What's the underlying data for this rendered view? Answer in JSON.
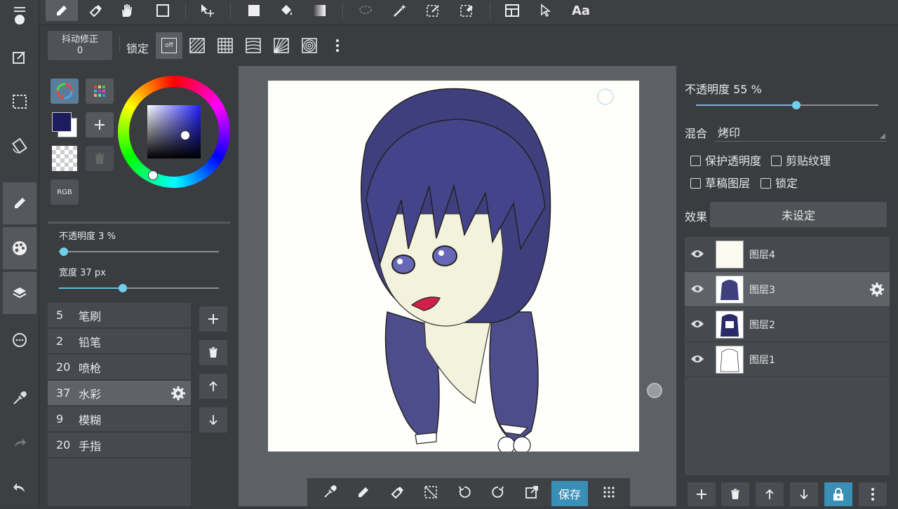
{
  "top_toolbar": {
    "text_tool_label": "Aa"
  },
  "sub_toolbar": {
    "stabilizer_label": "抖动修正",
    "stabilizer_value": "0",
    "lock_label": "锁定",
    "snap_off_label": "off"
  },
  "color_panel": {
    "rgb_label": "RGB",
    "primary_color": "#1d1d5e",
    "opacity_label": "不透明度",
    "opacity_value": "3",
    "opacity_unit": "%",
    "opacity_fraction": 0.03,
    "width_label": "宽度",
    "width_value": "37",
    "width_unit": "px",
    "width_fraction": 0.4
  },
  "brushes": [
    {
      "size": "5",
      "name": "笔刷"
    },
    {
      "size": "2",
      "name": "铅笔"
    },
    {
      "size": "20",
      "name": "喷枪"
    },
    {
      "size": "37",
      "name": "水彩"
    },
    {
      "size": "9",
      "name": "模糊"
    },
    {
      "size": "20",
      "name": "手指"
    }
  ],
  "layer_panel": {
    "opacity_label": "不透明度",
    "opacity_value": "55",
    "opacity_unit": "%",
    "opacity_fraction": 0.55,
    "blend_label": "混合",
    "blend_value": "烤印",
    "protect_alpha_label": "保护透明度",
    "clipping_label": "剪贴纹理",
    "draft_layer_label": "草稿图层",
    "lock_label": "锁定",
    "effect_label": "效果",
    "effect_value": "未设定",
    "layers": [
      {
        "name": "图层4"
      },
      {
        "name": "图层3"
      },
      {
        "name": "图层2"
      },
      {
        "name": "图层1"
      }
    ]
  },
  "bottom_toolbar": {
    "save_label": "保存"
  },
  "colors": {
    "accent": "#5fc1e0",
    "save_bg": "#3a8fb7",
    "lock_bg": "#3a8fb7",
    "hair": "#3f3f7e",
    "skin": "#f2f2dd"
  }
}
